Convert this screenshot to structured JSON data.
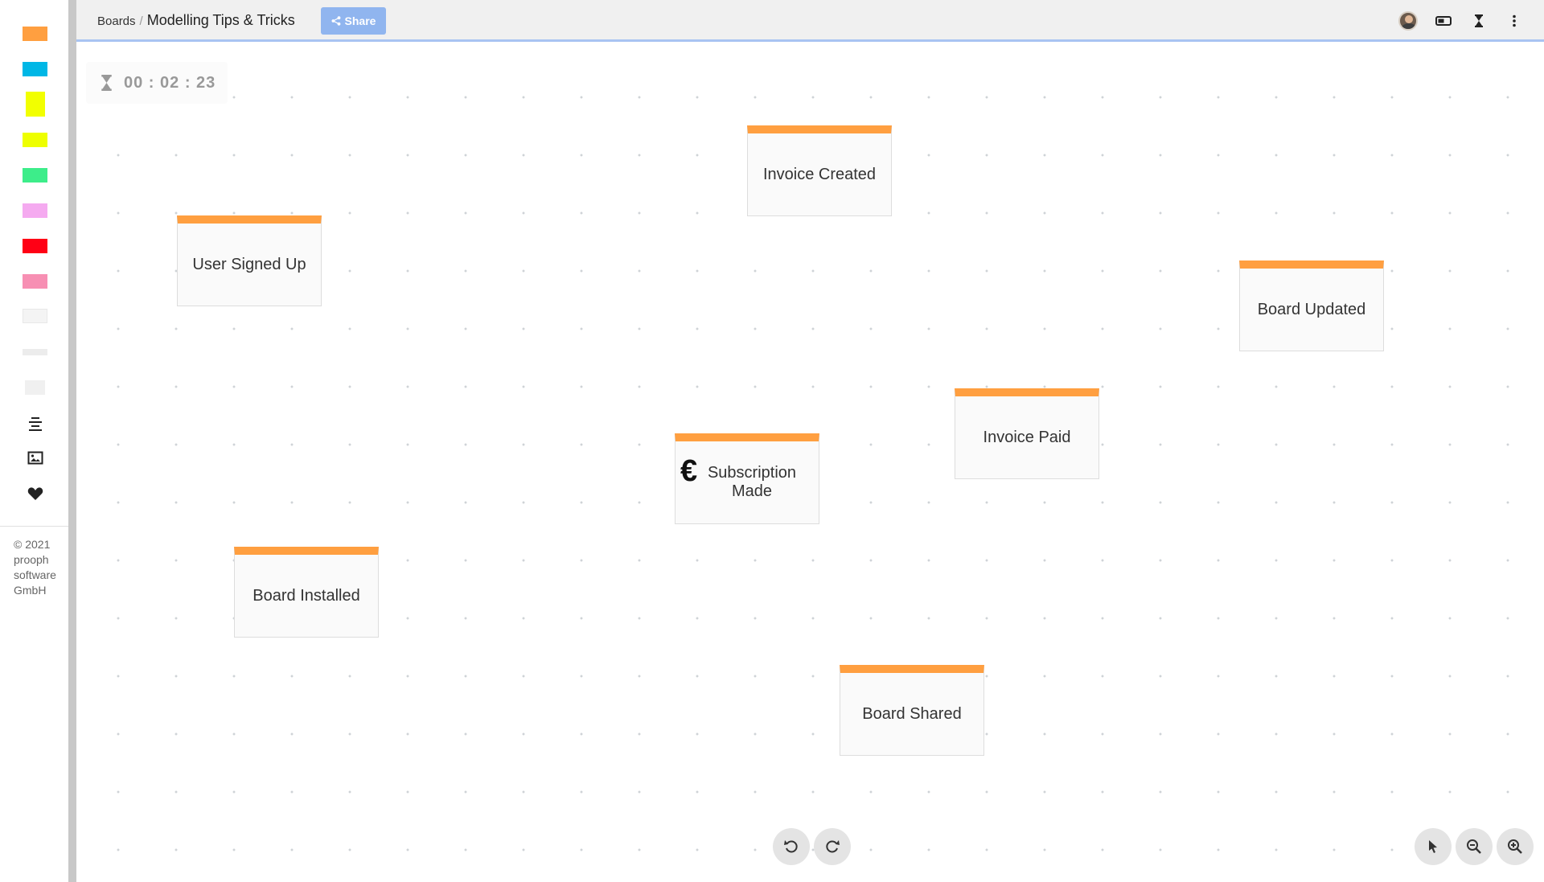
{
  "sidebar": {
    "swatches": [
      {
        "name": "orange",
        "color": "#ff9f40"
      },
      {
        "name": "blue",
        "color": "#00b7e6"
      },
      {
        "name": "yellow-tall",
        "color": "#f2ff00"
      },
      {
        "name": "yellow",
        "color": "#eeff00"
      },
      {
        "name": "green",
        "color": "#3ded8a"
      },
      {
        "name": "pink",
        "color": "#f5aaf0"
      },
      {
        "name": "red",
        "color": "#ff0015"
      },
      {
        "name": "rose",
        "color": "#f78fb3"
      },
      {
        "name": "white",
        "color": "#f4f4f4"
      },
      {
        "name": "light-grey",
        "color": "#ececec"
      },
      {
        "name": "grey",
        "color": "#f0f0f0"
      }
    ],
    "tools": [
      "text-align-icon",
      "image-icon",
      "heart-icon"
    ],
    "copyright": "© 2021 prooph software GmbH"
  },
  "header": {
    "breadcrumb_link": "Boards",
    "breadcrumb_sep": "/",
    "board_title": "Modelling Tips & Tricks",
    "share_label": "Share",
    "icons": [
      "avatar",
      "toggle-icon",
      "hourglass-icon",
      "more-vert-icon"
    ]
  },
  "timer": {
    "value": "00 : 02 : 23"
  },
  "stickies": [
    {
      "id": "invoice-created",
      "label": "Invoice Created",
      "color": "#ff9f40"
    },
    {
      "id": "user-signed-up",
      "label": "User Signed Up",
      "color": "#ff9f40"
    },
    {
      "id": "board-updated",
      "label": "Board Updated",
      "color": "#ff9f40"
    },
    {
      "id": "invoice-paid",
      "label": "Invoice Paid",
      "color": "#ff9f40"
    },
    {
      "id": "subscription-made",
      "label": "Subscription Made",
      "color": "#ff9f40",
      "icon": "euro-icon",
      "icon_glyph": "€"
    },
    {
      "id": "board-installed",
      "label": "Board Installed",
      "color": "#ff9f40"
    },
    {
      "id": "board-shared",
      "label": "Board Shared",
      "color": "#ff9f40"
    }
  ],
  "controls": [
    "undo-icon",
    "redo-icon",
    "cursor-icon",
    "zoom-out-icon",
    "zoom-in-icon"
  ]
}
